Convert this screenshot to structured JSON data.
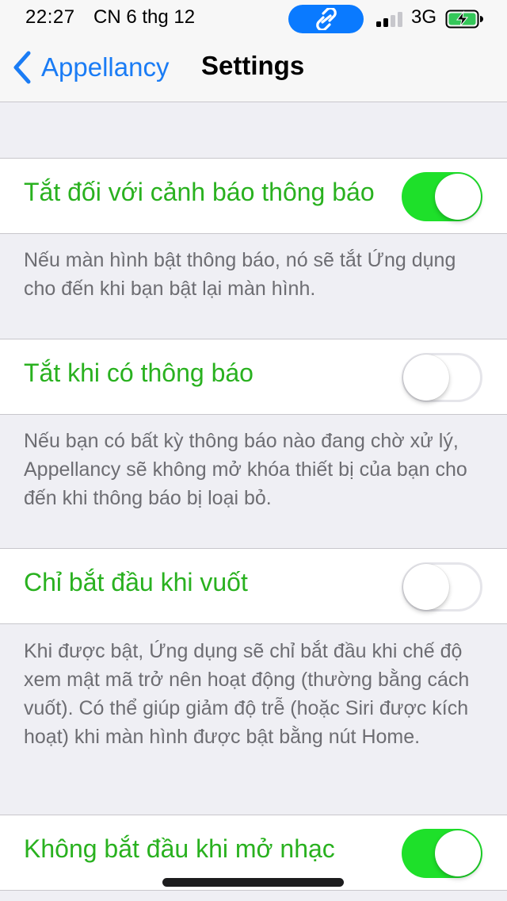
{
  "status_bar": {
    "time": "22:27",
    "date": "CN 6 thg 12",
    "network": "3G",
    "pill_icon": "link-icon",
    "pill_color": "#0a7aff"
  },
  "nav": {
    "back_label": "Appellancy",
    "title": "Settings",
    "accent": "#1a7cf5"
  },
  "settings": [
    {
      "label": "Tắt đối với cảnh báo thông báo",
      "enabled": true,
      "footer": "Nếu màn hình bật thông báo, nó sẽ tắt Ứng dụng cho đến khi bạn bật lại màn hình."
    },
    {
      "label": "Tắt khi có thông báo",
      "enabled": false,
      "footer": "Nếu bạn có bất kỳ thông báo nào đang chờ xử lý, Appellancy sẽ không mở khóa thiết bị của bạn cho đến khi thông báo bị loại bỏ."
    },
    {
      "label": "Chỉ bắt đầu khi vuốt",
      "enabled": false,
      "footer": "Khi được bật, Ứng dụng sẽ chỉ bắt đầu khi chế độ xem mật mã trở nên hoạt động (thường bằng cách vuốt). Có thể giúp giảm độ trễ (hoặc Siri được kích hoạt) khi màn hình được bật bằng nút Home."
    },
    {
      "label": "Không bắt đầu khi mở nhạc",
      "enabled": true
    }
  ],
  "colors": {
    "label_green": "#29b11f",
    "toggle_on": "#1ee02a",
    "background": "#efeff4",
    "footer_gray": "#6d6d72"
  }
}
